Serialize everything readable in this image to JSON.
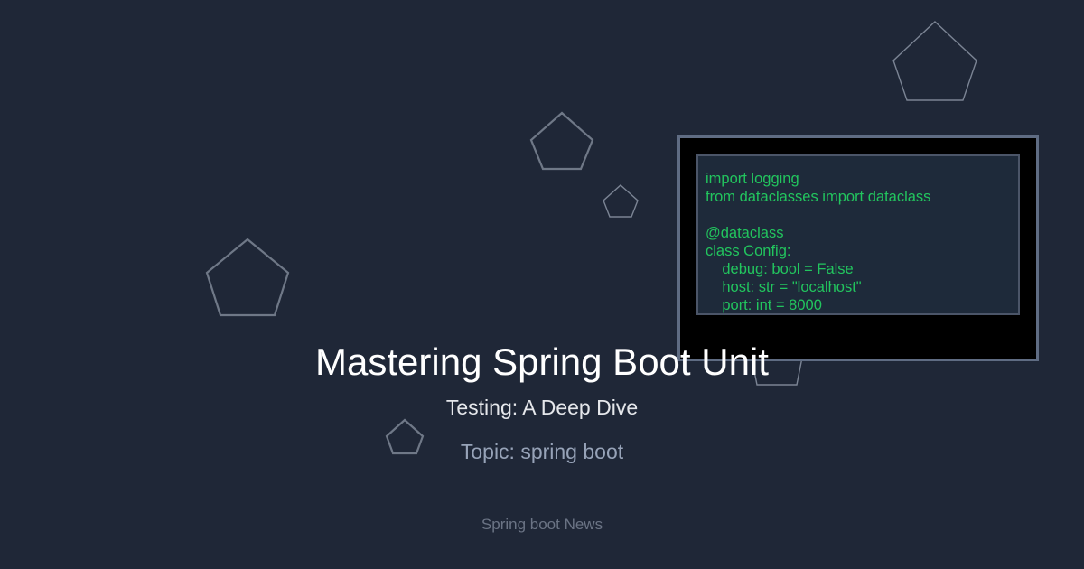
{
  "code_snippet": {
    "lines": [
      "import logging",
      "from dataclasses import dataclass",
      "",
      "@dataclass",
      "class Config:",
      "    debug: bool = False",
      "    host: str = \"localhost\"",
      "    port: int = 8000"
    ],
    "text_color": "#22c55e"
  },
  "headline": {
    "title": "Mastering Spring Boot Unit",
    "subtitle": "Testing: A Deep Dive"
  },
  "topic_label": "Topic: spring boot",
  "footer_label": "Spring boot News",
  "colors": {
    "background": "#1f2737",
    "title": "#ffffff",
    "topic": "#97a3b8",
    "footer": "#6b7485",
    "shape_stroke": "#6f7887"
  },
  "decorations": {
    "icon": "pentagon-outline",
    "count": 7
  }
}
